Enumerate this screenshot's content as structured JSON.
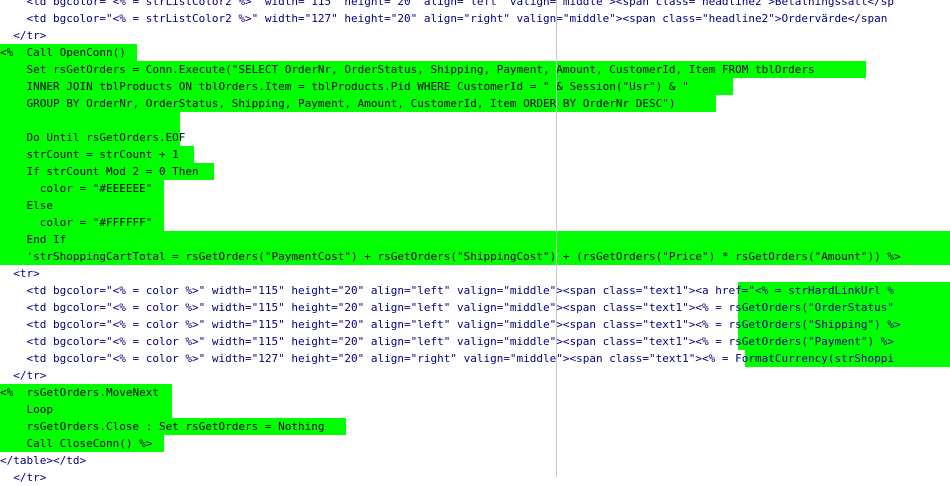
{
  "editor": {
    "lines": [
      {
        "kind": "html",
        "text": "    <td bgcolor=\"<% = strListColor2 %>\" width=\"115\" height=\"20\" align=\"left\" valign=\"middle\"><span class=\"headline2\">Betalningssätt</sp"
      },
      {
        "kind": "html",
        "text": "    <td bgcolor=\"<% = strListColor2 %>\" width=\"127\" height=\"20\" align=\"right\" valign=\"middle\"><span class=\"headline2\">Ordervärde</span"
      },
      {
        "kind": "html",
        "text": "  </tr>"
      },
      {
        "kind": "asp",
        "hl_end": 137,
        "text": "<%  Call OpenConn()"
      },
      {
        "kind": "asp",
        "hl_end": 866,
        "text": "    Set rsGetOrders = Conn.Execute(\"SELECT OrderNr, OrderStatus, Shipping, Payment, Amount, CustomerId, Item FROM tblOrders"
      },
      {
        "kind": "asp",
        "hl_end": 733,
        "text": "    INNER JOIN tblProducts ON tblOrders.Item = tblProducts.Pid WHERE CustomerId = \" & Session(\"Usr\") & \""
      },
      {
        "kind": "asp",
        "hl_end": 716,
        "text": "    GROUP BY OrderNr, OrderStatus, Shipping, Payment, Amount, CustomerId, Item ORDER BY OrderNr DESC\")"
      },
      {
        "kind": "asp",
        "hl_end": 180,
        "text": ""
      },
      {
        "kind": "asp",
        "hl_end": 180,
        "text": "    Do Until rsGetOrders.EOF"
      },
      {
        "kind": "asp",
        "hl_end": 194,
        "text": "    strCount = strCount + 1"
      },
      {
        "kind": "asp",
        "hl_end": 214,
        "text": "    If strCount Mod 2 = 0 Then"
      },
      {
        "kind": "asp",
        "hl_end": 164,
        "text": "      color = \"#EEEEEE\""
      },
      {
        "kind": "asp",
        "hl_end": 164,
        "text": "    Else"
      },
      {
        "kind": "asp",
        "hl_end": 164,
        "text": "      color = \"#FFFFFF\""
      },
      {
        "kind": "asp",
        "hl_end": 950,
        "text": "    End If"
      },
      {
        "kind": "asp",
        "hl_end": 950,
        "text": "    'strShoppingCartTotal = rsGetOrders(\"PaymentCost\") + rsGetOrders(\"ShippingCost\") + (rsGetOrders(\"Price\") * rsGetOrders(\"Amount\")) %>"
      },
      {
        "kind": "html",
        "text": "  <tr>"
      },
      {
        "kind": "mixed",
        "hl_start": 738,
        "text": "    <td bgcolor=\"<% = color %>\" width=\"115\" height=\"20\" align=\"left\" valign=\"middle\"><span class=\"text1\"><a href=\"<% = strHardLinkUrl %"
      },
      {
        "kind": "mixed",
        "hl_start": 738,
        "text": "    <td bgcolor=\"<% = color %>\" width=\"115\" height=\"20\" align=\"left\" valign=\"middle\"><span class=\"text1\"><% = rsGetOrders(\"OrderStatus\""
      },
      {
        "kind": "mixed",
        "hl_start": 738,
        "text": "    <td bgcolor=\"<% = color %>\" width=\"115\" height=\"20\" align=\"left\" valign=\"middle\"><span class=\"text1\"><% = rsGetOrders(\"Shipping\") %>"
      },
      {
        "kind": "mixed",
        "hl_start": 738,
        "text": "    <td bgcolor=\"<% = color %>\" width=\"115\" height=\"20\" align=\"left\" valign=\"middle\"><span class=\"text1\"><% = rsGetOrders(\"Payment\") %>"
      },
      {
        "kind": "mixed",
        "hl_start": 745,
        "text": "    <td bgcolor=\"<% = color %>\" width=\"127\" height=\"20\" align=\"right\" valign=\"middle\"><span class=\"text1\"><% = FormatCurrency(strShoppi"
      },
      {
        "kind": "html",
        "text": "  </tr>"
      },
      {
        "kind": "asp",
        "hl_end": 172,
        "text": "<%  rsGetOrders.MoveNext"
      },
      {
        "kind": "asp",
        "hl_end": 172,
        "text": "    Loop"
      },
      {
        "kind": "asp",
        "hl_end": 346,
        "text": "    rsGetOrders.Close : Set rsGetOrders = Nothing"
      },
      {
        "kind": "asp",
        "hl_end": 164,
        "text": "    Call CloseConn() %>"
      },
      {
        "kind": "html",
        "text": "</table></td>"
      },
      {
        "kind": "html",
        "text": "  </tr>"
      }
    ],
    "highlight_color": "#00ff00",
    "code_color": "#000080"
  }
}
